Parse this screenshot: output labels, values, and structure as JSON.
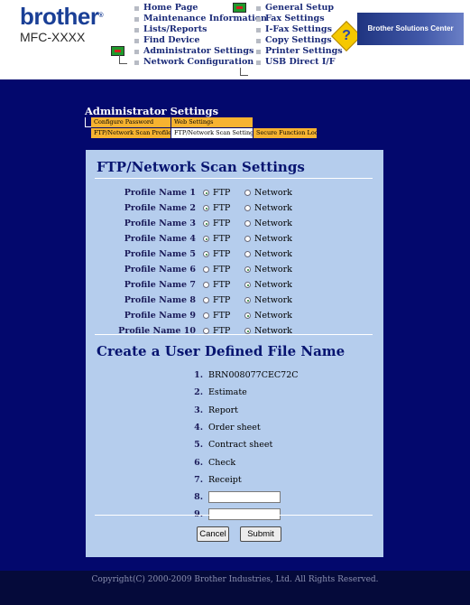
{
  "header": {
    "brand": "brother",
    "model": "MFC-XXXX",
    "nav_left": [
      "Home Page",
      "Maintenance Information",
      "Lists/Reports",
      "Find Device",
      "Administrator Settings",
      "Network Configuration"
    ],
    "nav_right": [
      "General Setup",
      "Fax Settings",
      "I-Fax Settings",
      "Copy Settings",
      "Printer Settings",
      "USB Direct I/F"
    ],
    "solutions_center": "Brother Solutions Center",
    "help_glyph": "?"
  },
  "section": {
    "title": "Administrator Settings",
    "tabs": [
      "Configure Password",
      "Web Settings",
      "FTP/Network Scan Profile",
      "FTP/Network Scan Settings",
      "Secure Function Lock"
    ],
    "active_tab": "FTP/Network Scan Settings"
  },
  "form": {
    "title": "FTP/Network Scan Settings",
    "option_ftp": "FTP",
    "option_network": "Network",
    "profiles": [
      {
        "name": "Profile Name 1",
        "selected": "FTP"
      },
      {
        "name": "Profile Name 2",
        "selected": "FTP"
      },
      {
        "name": "Profile Name 3",
        "selected": "FTP"
      },
      {
        "name": "Profile Name 4",
        "selected": "FTP"
      },
      {
        "name": "Profile Name 5",
        "selected": "FTP"
      },
      {
        "name": "Profile Name 6",
        "selected": "Network"
      },
      {
        "name": "Profile Name 7",
        "selected": "Network"
      },
      {
        "name": "Profile Name 8",
        "selected": "Network"
      },
      {
        "name": "Profile Name 9",
        "selected": "Network"
      },
      {
        "name": "Profile Name 10",
        "selected": "Network"
      }
    ],
    "file_name_title": "Create a User Defined File Name",
    "file_names": [
      {
        "num": "1.",
        "value": "BRN008077CEC72C"
      },
      {
        "num": "2.",
        "value": "Estimate"
      },
      {
        "num": "3.",
        "value": "Report"
      },
      {
        "num": "4.",
        "value": "Order sheet"
      },
      {
        "num": "5.",
        "value": "Contract sheet"
      },
      {
        "num": "6.",
        "value": "Check"
      },
      {
        "num": "7.",
        "value": "Receipt"
      },
      {
        "num": "8.",
        "value": "",
        "editable": true
      },
      {
        "num": "9.",
        "value": "",
        "editable": true
      }
    ],
    "cancel_label": "Cancel",
    "submit_label": "Submit"
  },
  "footer": {
    "copyright": "Copyright(C) 2000-2009 Brother Industries, Ltd. All Rights Reserved."
  },
  "colors": {
    "background": "#03086d",
    "panel": "#b5cded",
    "tab_orange": "#f7b330",
    "heading": "#071470"
  }
}
